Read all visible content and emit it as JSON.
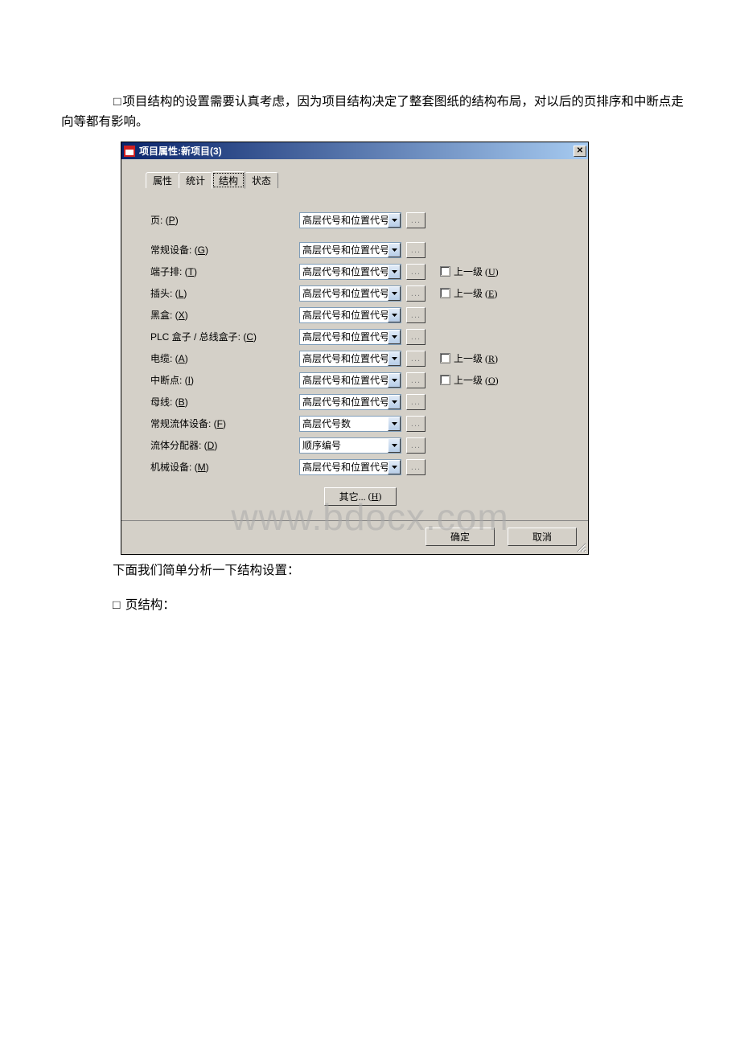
{
  "doc": {
    "para1": "项目结构的设置需要认真考虑，因为项目结构决定了整套图纸的结构布局，对以后的页排序和中断点走向等都有影响。",
    "para2": "下面我们简单分析一下结构设置：",
    "para3": "页结构：",
    "bullet": "□"
  },
  "watermark": "www.bdocx.com",
  "dialog": {
    "title": "项目属性:新项目(3)",
    "tabs": [
      "属性",
      "统计",
      "结构",
      "状态"
    ],
    "activeTab": 2,
    "rows": [
      {
        "label": "页:",
        "hotkey": "P",
        "value": "高层代号和位置代号",
        "checkbox": null
      },
      {
        "label": "常规设备:",
        "hotkey": "G",
        "value": "高层代号和位置代号",
        "checkbox": null
      },
      {
        "label": "端子排:",
        "hotkey": "T",
        "value": "高层代号和位置代号",
        "checkbox": {
          "label": "上一级",
          "hotkey": "U"
        }
      },
      {
        "label": "插头:",
        "hotkey": "L",
        "value": "高层代号和位置代号",
        "checkbox": {
          "label": "上一级",
          "hotkey": "E"
        }
      },
      {
        "label": "黑盒:",
        "hotkey": "X",
        "value": "高层代号和位置代号",
        "checkbox": null
      },
      {
        "label": "PLC 盒子 / 总线盒子:",
        "hotkey": "C",
        "value": "高层代号和位置代号",
        "checkbox": null
      },
      {
        "label": "电缆:",
        "hotkey": "A",
        "value": "高层代号和位置代号",
        "checkbox": {
          "label": "上一级",
          "hotkey": "R"
        }
      },
      {
        "label": "中断点:",
        "hotkey": "I",
        "value": "高层代号和位置代号",
        "checkbox": {
          "label": "上一级",
          "hotkey": "O"
        }
      },
      {
        "label": "母线:",
        "hotkey": "B",
        "value": "高层代号和位置代号",
        "checkbox": null
      },
      {
        "label": "常规流体设备:",
        "hotkey": "F",
        "value": "高层代号数",
        "checkbox": null
      },
      {
        "label": "流体分配器:",
        "hotkey": "D",
        "value": "顺序编号",
        "checkbox": null
      },
      {
        "label": "机械设备:",
        "hotkey": "M",
        "value": "高层代号和位置代号",
        "checkbox": null
      }
    ],
    "otherButton": {
      "label": "其它...",
      "hotkey": "H"
    },
    "ok": "确定",
    "cancel": "取消",
    "ellipsis": "..."
  }
}
